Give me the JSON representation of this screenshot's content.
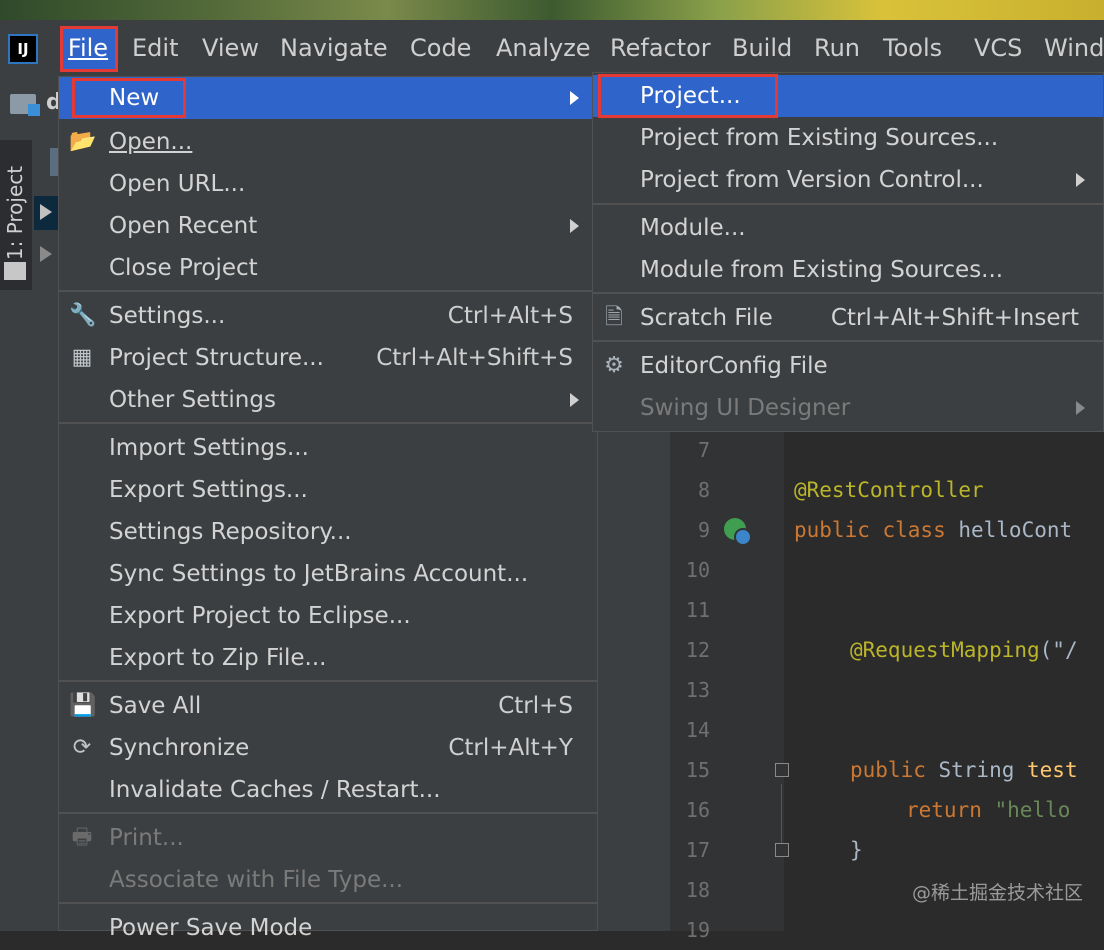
{
  "app": {
    "logo_text": "IJ"
  },
  "menubar": {
    "items": [
      {
        "label": "File",
        "mnemonic": "F"
      },
      {
        "label": "Edit"
      },
      {
        "label": "View"
      },
      {
        "label": "Navigate"
      },
      {
        "label": "Code"
      },
      {
        "label": "Analyze"
      },
      {
        "label": "Refactor"
      },
      {
        "label": "Build"
      },
      {
        "label": "Run"
      },
      {
        "label": "Tools"
      },
      {
        "label": "VCS"
      },
      {
        "label": "Wind"
      }
    ]
  },
  "navbar": {
    "project_initial": "d"
  },
  "toolwindow": {
    "project_label": "1: Project"
  },
  "file_menu": {
    "new": "New",
    "open": "Open...",
    "open_url": "Open URL...",
    "open_recent": "Open Recent",
    "close_project": "Close Project",
    "settings": "Settings...",
    "settings_shortcut": "Ctrl+Alt+S",
    "project_structure": "Project Structure...",
    "project_structure_shortcut": "Ctrl+Alt+Shift+S",
    "other_settings": "Other Settings",
    "import_settings": "Import Settings...",
    "export_settings": "Export Settings...",
    "settings_repository": "Settings Repository...",
    "sync_settings": "Sync Settings to JetBrains Account...",
    "export_eclipse": "Export Project to Eclipse...",
    "export_zip": "Export to Zip File...",
    "save_all": "Save All",
    "save_all_shortcut": "Ctrl+S",
    "synchronize": "Synchronize",
    "synchronize_shortcut": "Ctrl+Alt+Y",
    "invalidate_caches": "Invalidate Caches / Restart...",
    "print": "Print...",
    "associate_file_type": "Associate with File Type...",
    "power_save_mode": "Power Save Mode"
  },
  "new_submenu": {
    "project": "Project...",
    "project_existing": "Project from Existing Sources...",
    "project_vcs": "Project from Version Control...",
    "module": "Module...",
    "module_existing": "Module from Existing Sources...",
    "scratch_file": "Scratch File",
    "scratch_file_shortcut": "Ctrl+Alt+Shift+Insert",
    "editorconfig": "EditorConfig File",
    "swing_designer": "Swing UI Designer"
  },
  "editor": {
    "line_numbers": [
      "7",
      "8",
      "9",
      "10",
      "11",
      "12",
      "13",
      "14",
      "15",
      "16",
      "17",
      "18",
      "19"
    ],
    "line8": "@RestController",
    "line9_kw": "public class",
    "line9_rest": " helloCont",
    "line12_ann": "@RequestMapping",
    "line12_rest": "(\"/",
    "line15_kw": "public",
    "line15_rest": " String ",
    "line15_name": "test",
    "line16_kw": "return",
    "line16_str": " \"hello",
    "line17": "}"
  },
  "watermark": "@稀土掘金技术社区"
}
